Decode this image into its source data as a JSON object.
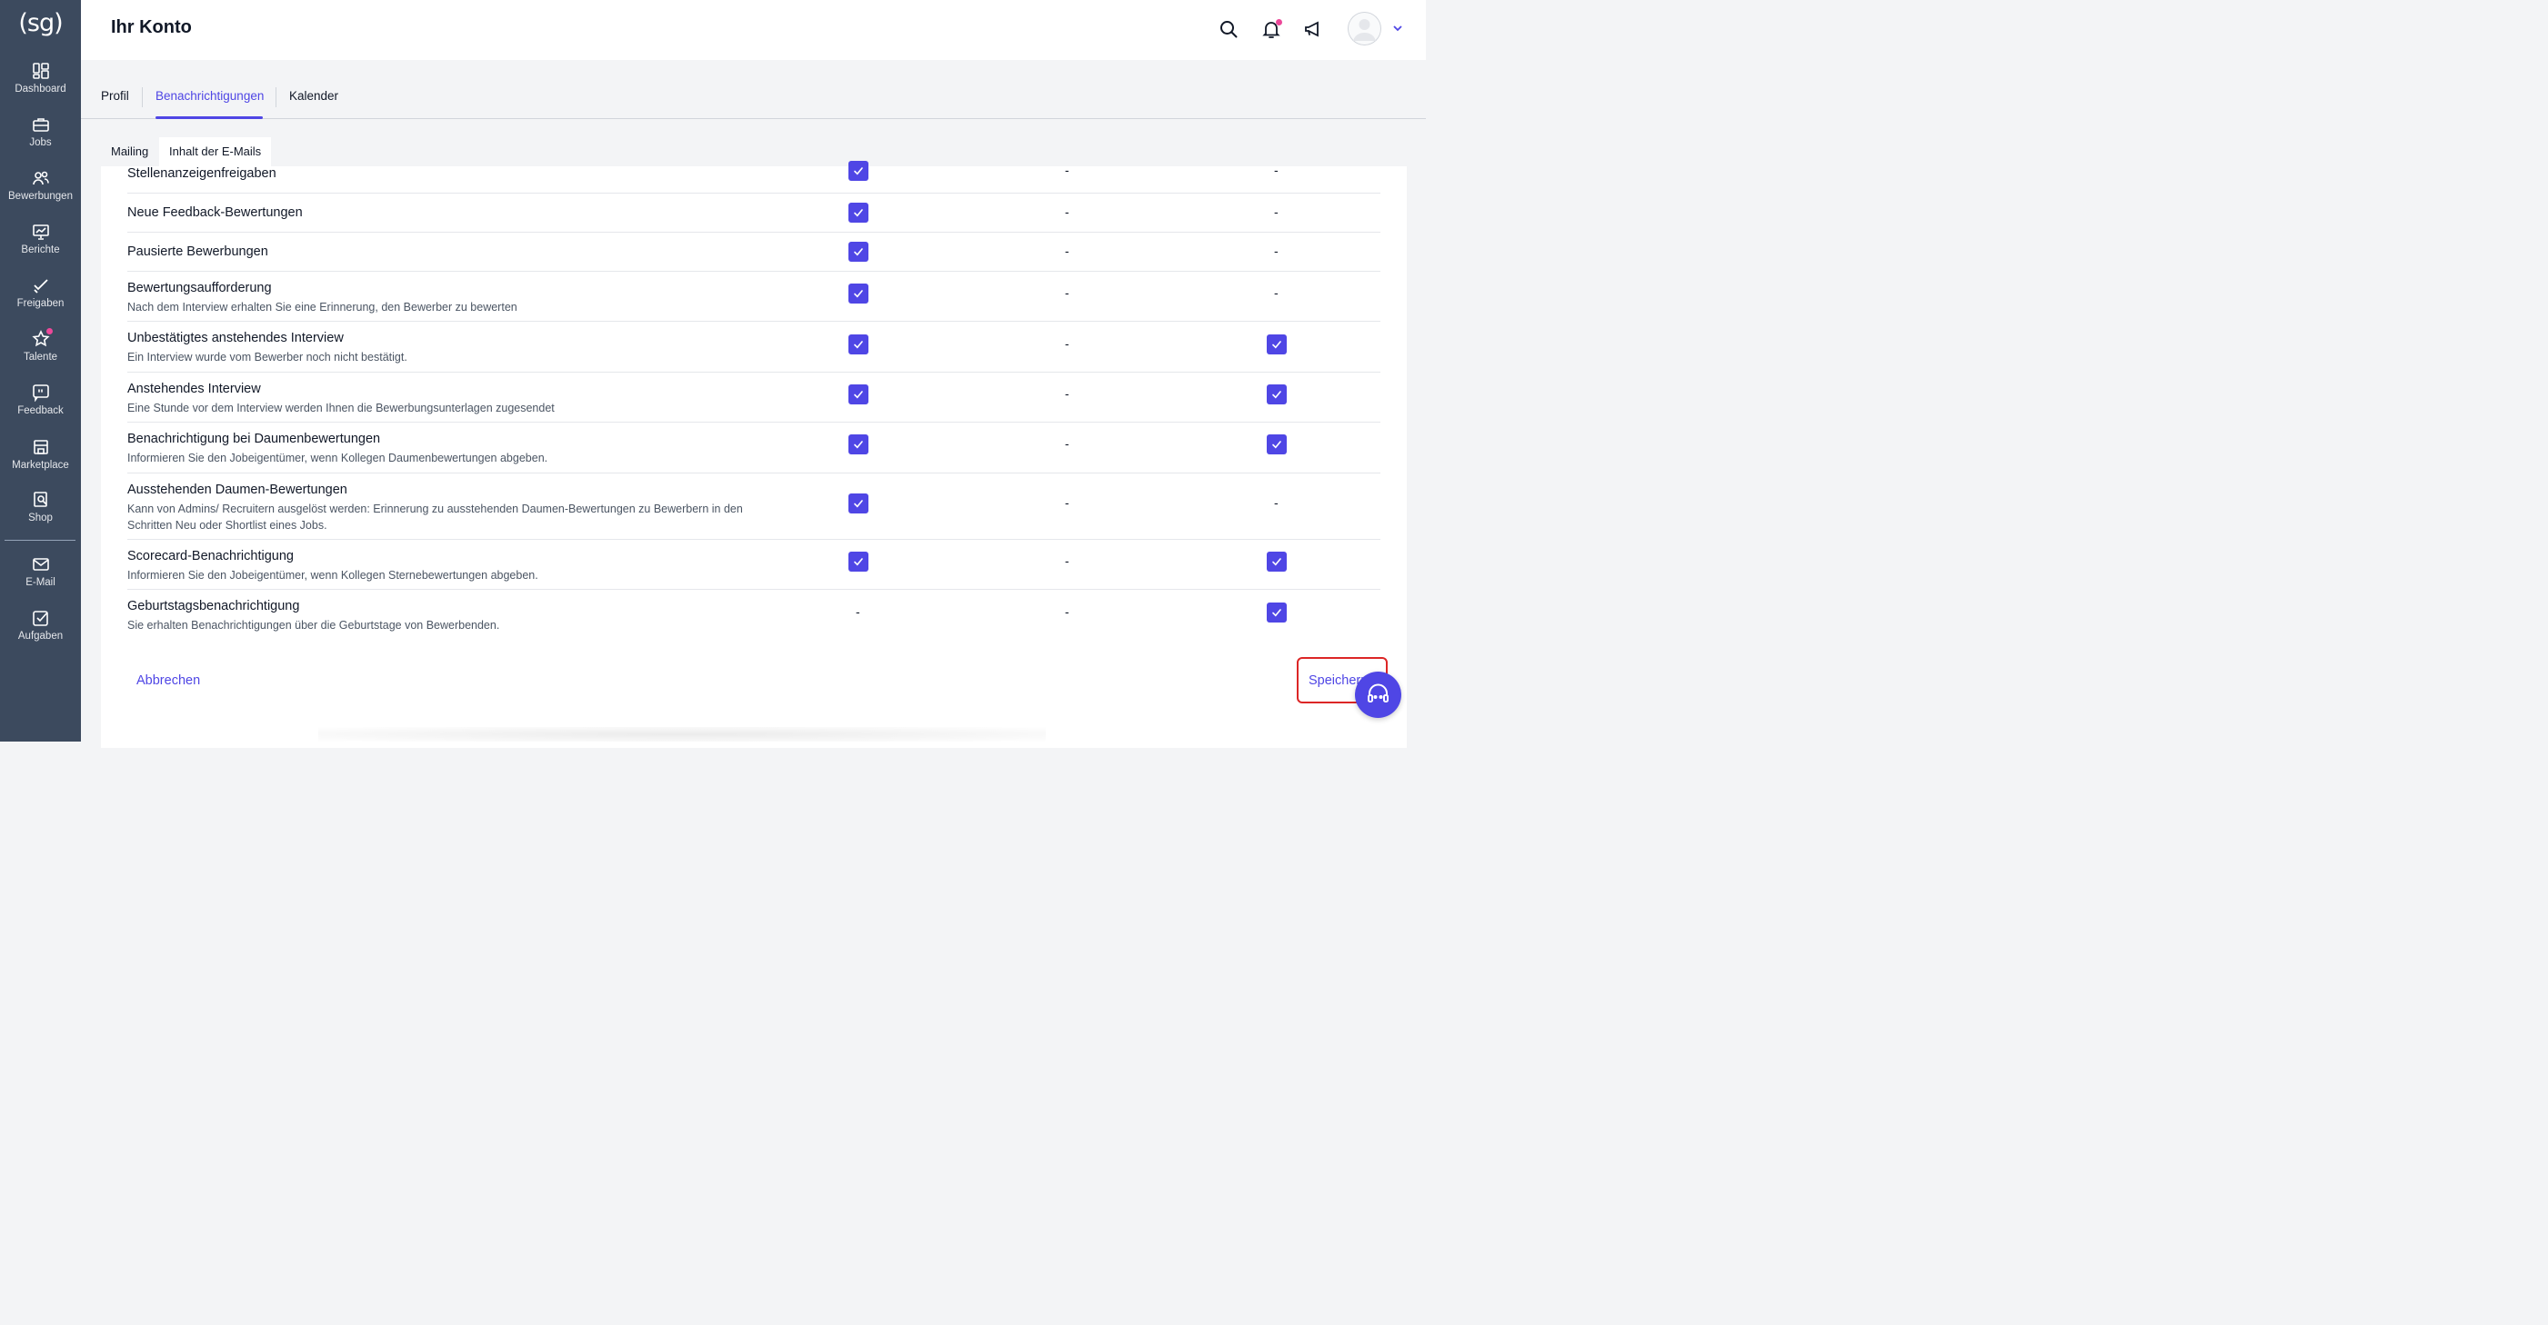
{
  "logo": "(sg)",
  "sidebar": {
    "items": [
      {
        "label": "Dashboard"
      },
      {
        "label": "Jobs"
      },
      {
        "label": "Bewerbungen"
      },
      {
        "label": "Berichte"
      },
      {
        "label": "Freigaben"
      },
      {
        "label": "Talente"
      },
      {
        "label": "Feedback"
      },
      {
        "label": "Marketplace"
      },
      {
        "label": "Shop"
      },
      {
        "label": "E-Mail"
      },
      {
        "label": "Aufgaben"
      }
    ]
  },
  "header": {
    "title": "Ihr Konto"
  },
  "tabs": [
    {
      "label": "Profil"
    },
    {
      "label": "Benachrichtigungen",
      "active": true
    },
    {
      "label": "Kalender"
    }
  ],
  "subtabs": [
    {
      "label": "Mailing"
    },
    {
      "label": "Inhalt der E-Mails",
      "active": true
    }
  ],
  "rows": [
    {
      "title": "Stellenanzeigenfreigaben",
      "desc": "",
      "col1": true,
      "col2": "-",
      "col3": "-"
    },
    {
      "title": "Neue Feedback-Bewertungen",
      "desc": "",
      "col1": true,
      "col2": "-",
      "col3": "-"
    },
    {
      "title": "Pausierte Bewerbungen",
      "desc": "",
      "col1": true,
      "col2": "-",
      "col3": "-"
    },
    {
      "title": "Bewertungsaufforderung",
      "desc": "Nach dem Interview erhalten Sie eine Erinnerung, den Bewerber zu bewerten",
      "col1": true,
      "col2": "-",
      "col3": "-"
    },
    {
      "title": "Unbestätigtes anstehendes Interview",
      "desc": "Ein Interview wurde vom Bewerber noch nicht bestätigt.",
      "col1": true,
      "col2": "-",
      "col3": true
    },
    {
      "title": "Anstehendes Interview",
      "desc": "Eine Stunde vor dem Interview werden Ihnen die Bewerbungsunterlagen zugesendet",
      "col1": true,
      "col2": "-",
      "col3": true
    },
    {
      "title": "Benachrichtigung bei Daumenbewertungen",
      "desc": "Informieren Sie den Jobeigentümer, wenn Kollegen Daumenbewertungen abgeben.",
      "col1": true,
      "col2": "-",
      "col3": true
    },
    {
      "title": "Ausstehenden Daumen-Bewertungen",
      "desc": "Kann von Admins/ Recruitern ausgelöst werden: Erinnerung zu ausstehenden Daumen-Bewertungen zu Bewerbern in den Schritten Neu oder Shortlist eines Jobs.",
      "col1": true,
      "col2": "-",
      "col3": "-"
    },
    {
      "title": "Scorecard-Benachrichtigung",
      "desc": "Informieren Sie den Jobeigentümer, wenn Kollegen Sternebewertungen abgeben.",
      "col1": true,
      "col2": "-",
      "col3": true
    },
    {
      "title": "Geburtstagsbenachrichtigung",
      "desc": "Sie erhalten Benachrichtigungen über die Geburtstage von Bewerbenden.",
      "col1": "-",
      "col2": "-",
      "col3": true
    }
  ],
  "actions": {
    "cancel": "Abbrechen",
    "save": "Speichern"
  },
  "colors": {
    "sidebar": "#3c4a5e",
    "accent": "#4f46e5",
    "notification_dot": "#ec4899",
    "highlight": "#dc2626"
  }
}
